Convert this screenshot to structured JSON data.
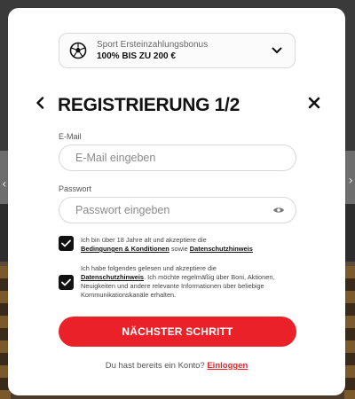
{
  "bonus": {
    "subtitle": "Sport Ersteinzahlungsbonus",
    "title": "100% BIS ZU 200 €"
  },
  "header": {
    "title": "REGISTRIERUNG",
    "step": "1/2"
  },
  "email": {
    "label": "E-Mail",
    "placeholder": "E-Mail eingeben"
  },
  "password": {
    "label": "Passwort",
    "placeholder": "Passwort eingeben"
  },
  "consent_age": {
    "text_before": "Ich bin über 18 Jahre alt und akzeptiere die",
    "link_terms": "Bedingungen & Konditionen",
    "text_middle": " sowie ",
    "link_privacy": "Datenschutzhinweis",
    "checked": true
  },
  "consent_marketing": {
    "text_before": "Ich habe folgendes gelesen und akzeptiere die",
    "link_privacy": "Datenschutzhinweis",
    "text_after": ". Ich möchte regelmäßig über Boni, Aktionen, Neuigkeiten und andere relevante Informationen über beliebige Kommunikationskanäle erhalten.",
    "checked": true
  },
  "cta": {
    "label": "NÄCHSTER SCHRITT"
  },
  "login": {
    "prompt": "Du hast bereits ein Konto?",
    "link": "Einloggen"
  },
  "colors": {
    "accent": "#ea2129",
    "text_dark": "#121212"
  }
}
